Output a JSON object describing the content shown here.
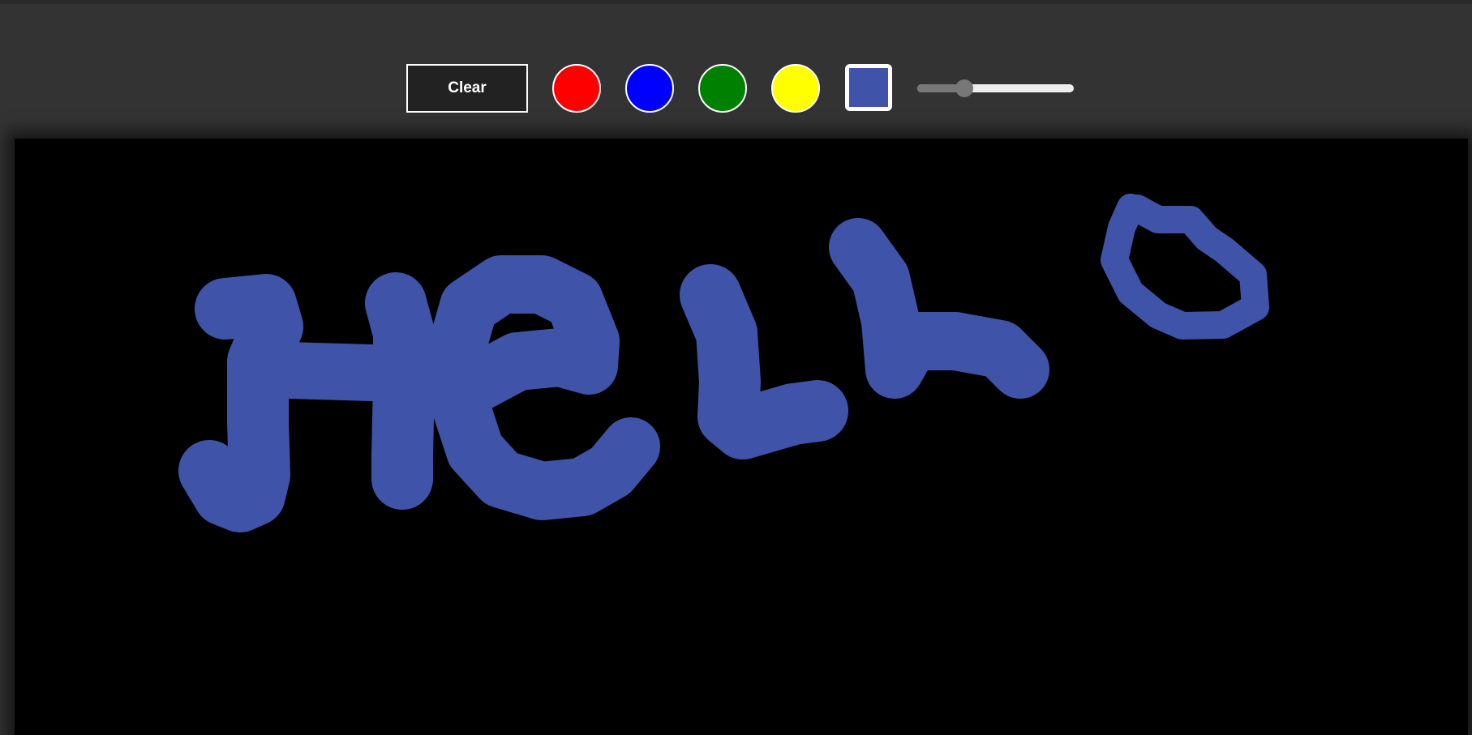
{
  "toolbar": {
    "clear_label": "Clear",
    "swatches": [
      {
        "name": "red",
        "color": "#ff0000"
      },
      {
        "name": "blue",
        "color": "#0000ff"
      },
      {
        "name": "green",
        "color": "#008000"
      },
      {
        "name": "yellow",
        "color": "#ffff00"
      }
    ],
    "current_color": "#3f54a8",
    "brush_size_fraction": 0.3
  },
  "canvas": {
    "background": "#000000",
    "stroke_color": "#3f54a8",
    "drawing_text_content": "HeLLo"
  }
}
